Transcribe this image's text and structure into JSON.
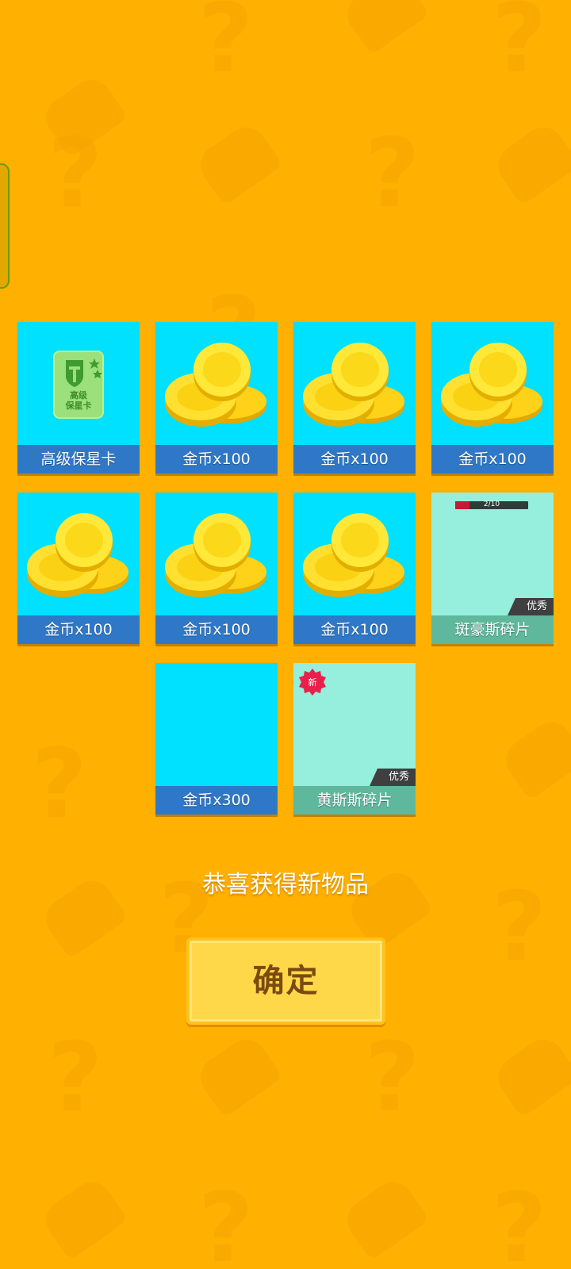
{
  "colors": {
    "background": "#FFB001",
    "card_blue": "#00E0FF",
    "card_shard": "#96EEDC",
    "label_blue": "#2F78C7",
    "label_shard": "#5FB89C",
    "button": "#FFD84A",
    "progress_fill": "#C81834"
  },
  "rewards": [
    {
      "label": "高级保星卡",
      "icon": "premium-star-protection-card-icon"
    },
    {
      "label": "金币x100",
      "icon": "gold-coins-icon"
    },
    {
      "label": "金币x100",
      "icon": "gold-coins-icon"
    },
    {
      "label": "金币x100",
      "icon": "gold-coins-icon"
    },
    {
      "label": "金币x100",
      "icon": "gold-coins-icon"
    },
    {
      "label": "金币x100",
      "icon": "gold-coins-icon"
    },
    {
      "label": "金币x100",
      "icon": "gold-coins-icon"
    },
    {
      "label": "斑豪斯碎片",
      "icon": "shard-icon",
      "rarity": "优秀",
      "progress": {
        "text": "2/10",
        "current": 2,
        "total": 10
      }
    },
    {
      "label": "金币x300",
      "icon": "gold-coins-icon"
    },
    {
      "label": "黄斯斯碎片",
      "icon": "shard-icon",
      "rarity": "优秀",
      "badge": "新"
    }
  ],
  "shield_card_text": "高级\n保星卡",
  "message": "恭喜获得新物品",
  "confirm_label": "确定"
}
